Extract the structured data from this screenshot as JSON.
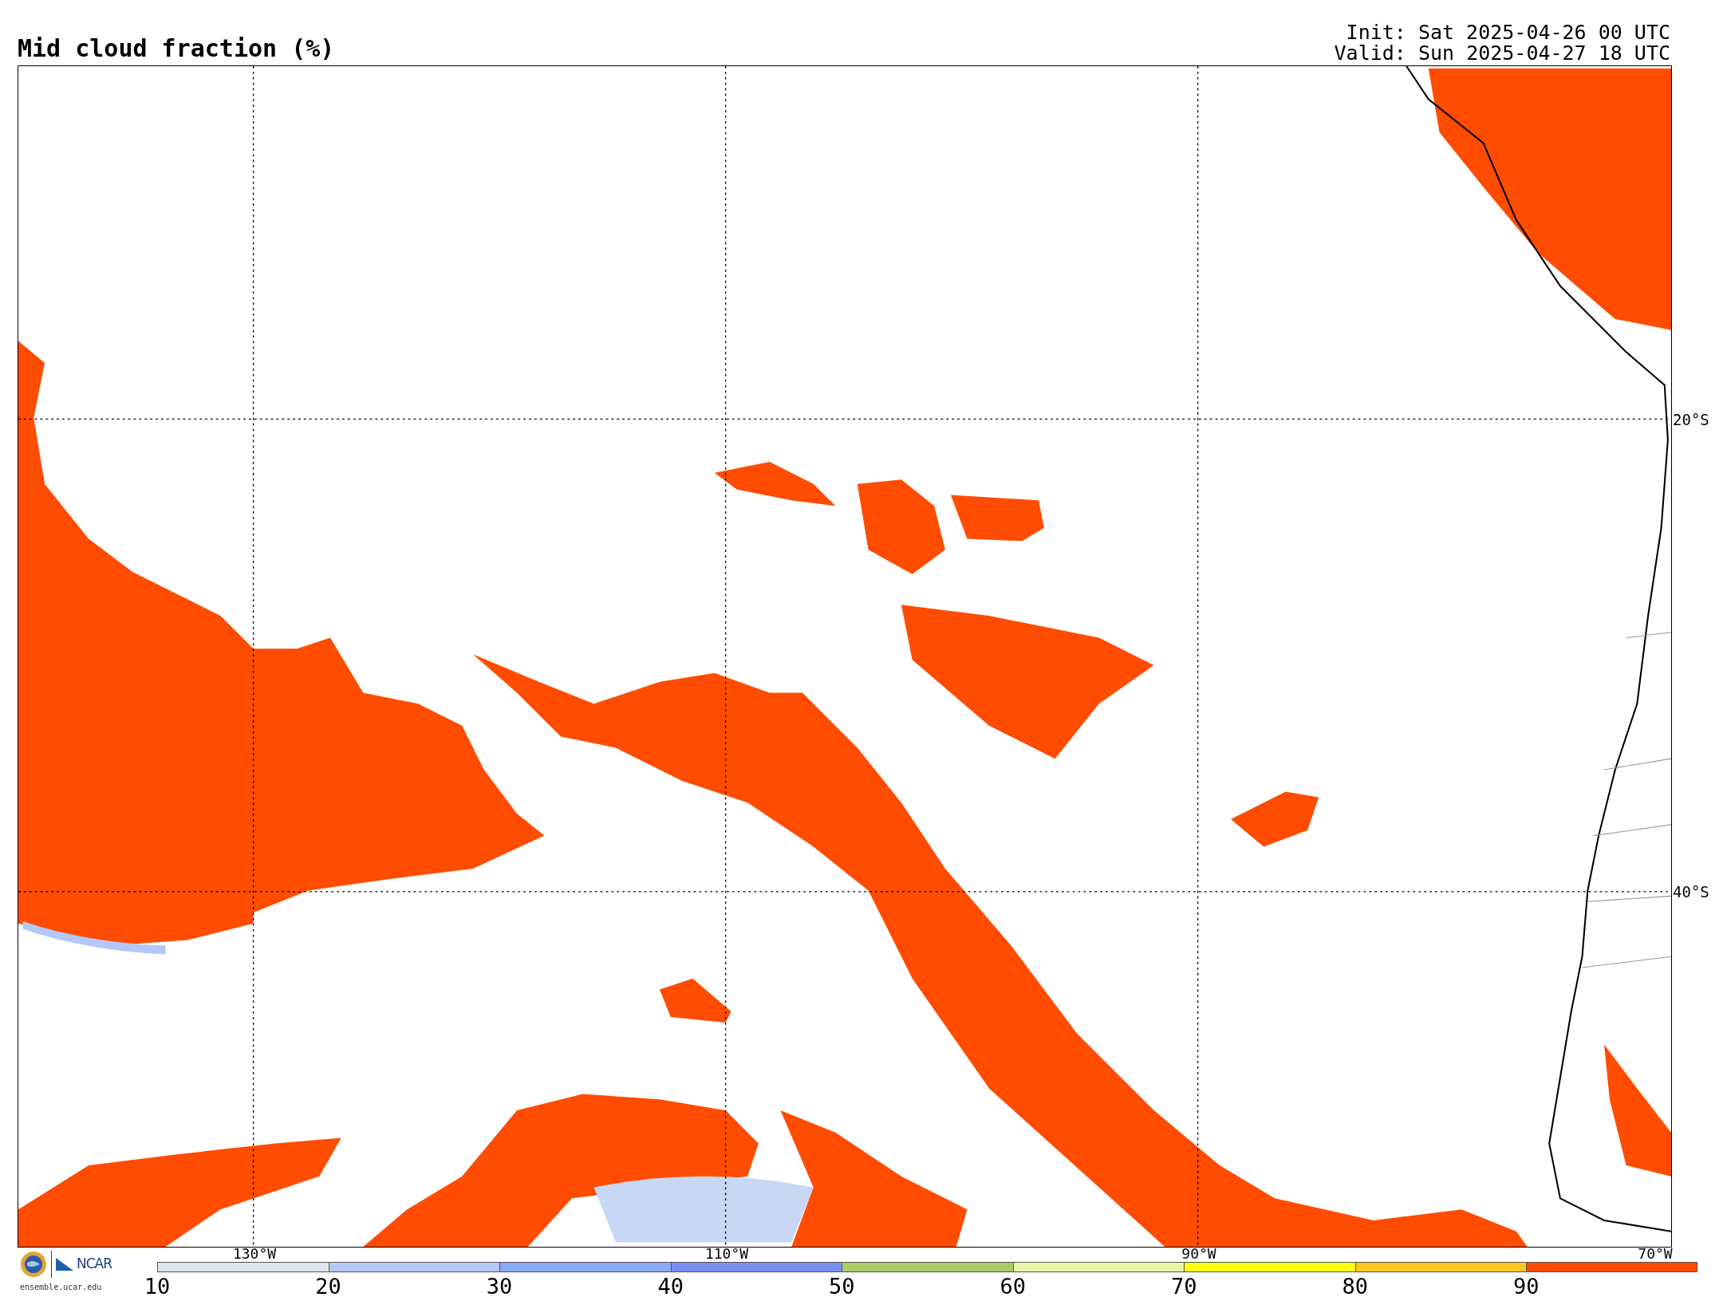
{
  "title": "Mid cloud fraction (%)",
  "init": "Init: Sat 2025-04-26 00 UTC",
  "valid": "Valid: Sun 2025-04-27 18 UTC",
  "map": {
    "lon_labels": [
      "130°W",
      "110°W",
      "90°W",
      "70°W"
    ],
    "lat_labels": [
      "20°S",
      "40°S"
    ]
  },
  "logo": {
    "org": "NCAR",
    "site": "ensemble.ucar.edu"
  },
  "colorbar": {
    "segments": [
      {
        "color": "#dce6ee"
      },
      {
        "color": "#b4c8f8"
      },
      {
        "color": "#8aaaf6"
      },
      {
        "color": "#7a8ef2"
      },
      {
        "color": "#a8cc66"
      },
      {
        "color": "#e8f5a8"
      },
      {
        "color": "#ffff10"
      },
      {
        "color": "#ffc820"
      },
      {
        "color": "#ff4c00"
      }
    ],
    "ticks": [
      "10",
      "20",
      "30",
      "40",
      "50",
      "60",
      "70",
      "80",
      "90"
    ]
  }
}
